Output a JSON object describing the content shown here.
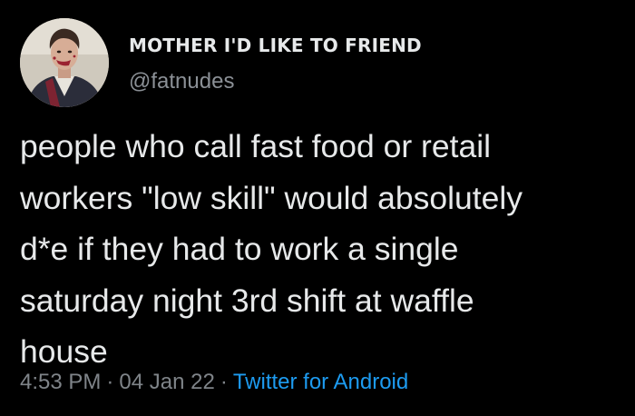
{
  "tweet": {
    "author": {
      "display_name": "MOTHER I'D LIKE TO FRIEND",
      "handle": "@fatnudes",
      "avatar_icon": "profile-photo"
    },
    "text": "people who call fast food or retail\nworkers \"low skill\" would absolutely\nd*e if they had to work a single\nsaturday night 3rd shift at waffle\nhouse",
    "meta": {
      "time": "4:53 PM",
      "separator": "·",
      "date": "04 Jan 22",
      "source": "Twitter for Android"
    },
    "colors": {
      "background": "#000000",
      "text": "#e7e9ea",
      "secondary": "#7f8489",
      "link": "#1d9bf0"
    }
  }
}
